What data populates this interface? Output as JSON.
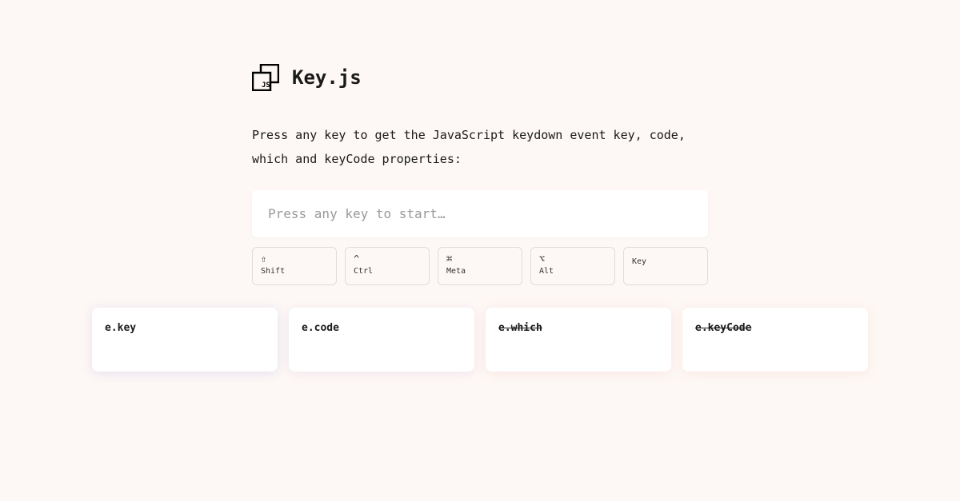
{
  "header": {
    "title": "Key.js"
  },
  "description": "Press any key to get the JavaScript keydown event key, code, which and keyCode properties:",
  "input": {
    "placeholder": "Press any key to start…"
  },
  "modifiers": [
    {
      "symbol": "⇧",
      "label": "Shift"
    },
    {
      "symbol": "^",
      "label": "Ctrl"
    },
    {
      "symbol": "⌘",
      "label": "Meta"
    },
    {
      "symbol": "⌥",
      "label": "Alt"
    },
    {
      "symbol": "",
      "label": "Key"
    }
  ],
  "cards": [
    {
      "label": "e.key",
      "deprecated": false
    },
    {
      "label": "e.code",
      "deprecated": false
    },
    {
      "label": "e.which",
      "deprecated": true
    },
    {
      "label": "e.keyCode",
      "deprecated": true
    }
  ]
}
